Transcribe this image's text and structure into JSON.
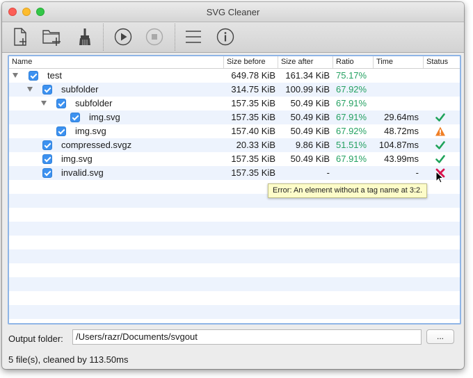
{
  "window": {
    "title": "SVG Cleaner"
  },
  "toolbar": {
    "add_file": "add-file-icon",
    "add_folder": "add-folder-icon",
    "clear": "broom-icon",
    "start": "play-icon",
    "stop": "stop-icon",
    "preferences": "menu-icon",
    "about": "info-icon"
  },
  "columns": [
    "Name",
    "Size before",
    "Size after",
    "Ratio",
    "Time",
    "Status"
  ],
  "rows": [
    {
      "name": "test",
      "size_before": "649.78 KiB",
      "size_after": "161.34 KiB",
      "ratio": "75.17%",
      "time": "",
      "status": ""
    },
    {
      "name": "subfolder",
      "size_before": "314.75 KiB",
      "size_after": "100.99 KiB",
      "ratio": "67.92%",
      "time": "",
      "status": ""
    },
    {
      "name": "subfolder",
      "size_before": "157.35 KiB",
      "size_after": "50.49 KiB",
      "ratio": "67.91%",
      "time": "",
      "status": ""
    },
    {
      "name": "img.svg",
      "size_before": "157.35 KiB",
      "size_after": "50.49 KiB",
      "ratio": "67.91%",
      "time": "29.64ms",
      "status": "ok"
    },
    {
      "name": "img.svg",
      "size_before": "157.40 KiB",
      "size_after": "50.49 KiB",
      "ratio": "67.92%",
      "time": "48.72ms",
      "status": "warning"
    },
    {
      "name": "compressed.svgz",
      "size_before": "20.33 KiB",
      "size_after": "9.86 KiB",
      "ratio": "51.51%",
      "time": "104.87ms",
      "status": "ok"
    },
    {
      "name": "img.svg",
      "size_before": "157.35 KiB",
      "size_after": "50.49 KiB",
      "ratio": "67.91%",
      "time": "43.99ms",
      "status": "ok"
    },
    {
      "name": "invalid.svg",
      "size_before": "157.35 KiB",
      "size_after": "-",
      "ratio": "",
      "time": "-",
      "status": "error"
    }
  ],
  "tooltip": "Error: An element without a tag name at 3:2.",
  "output": {
    "label": "Output folder:",
    "path": "/Users/razr/Documents/svgout",
    "browse": "..."
  },
  "status_text": "5 file(s), cleaned by 113.50ms",
  "colors": {
    "ratio": "#25a162",
    "ok": "#1fa35a",
    "warning": "#f07f26",
    "error": "#d9134d",
    "checkbox": "#3c91f0",
    "row_alt": "#edf3fd"
  }
}
